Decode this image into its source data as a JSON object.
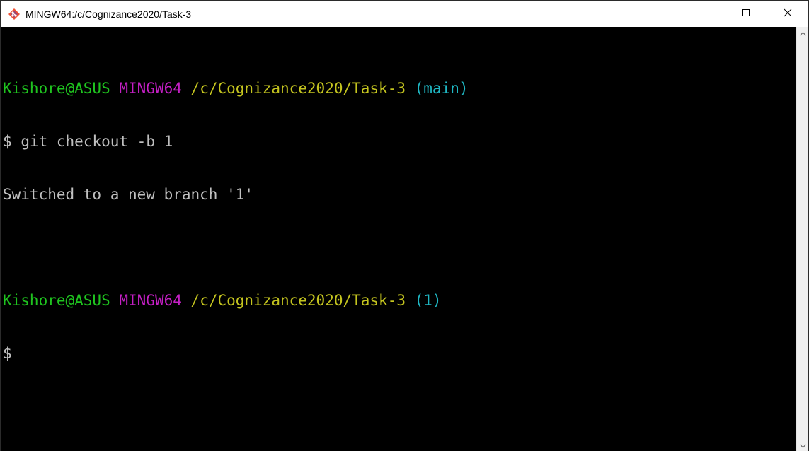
{
  "window": {
    "title": "MINGW64:/c/Cognizance2020/Task-3",
    "icon": "git-bash-icon",
    "controls": [
      "minimize-icon",
      "maximize-icon",
      "close-icon"
    ]
  },
  "terminal": {
    "colors": {
      "background": "#000000",
      "text": "#c0c0c0",
      "user": "#1fc41f",
      "system": "#c51fc5",
      "path": "#c4c41f",
      "branch": "#1fb8c4"
    },
    "block1": {
      "user": "Kishore@ASUS",
      "system": "MINGW64",
      "path": "/c/Cognizance2020/Task-3",
      "branch": "(main)",
      "prompt": "$",
      "command": "git checkout -b 1",
      "output": "Switched to a new branch '1'"
    },
    "block2": {
      "user": "Kishore@ASUS",
      "system": "MINGW64",
      "path": "/c/Cognizance2020/Task-3",
      "branch": "(1)",
      "prompt": "$"
    }
  }
}
